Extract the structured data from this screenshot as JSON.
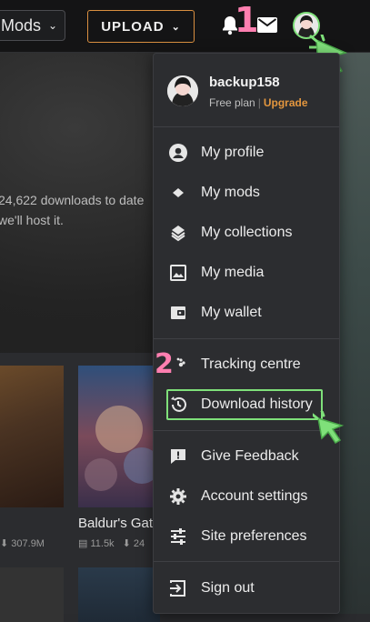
{
  "topbar": {
    "mods_label": "Mods",
    "upload_label": "UPLOAD"
  },
  "hero": {
    "line1": "24,622 downloads to date",
    "line2": "we'll host it."
  },
  "cards": {
    "card2_title": "Baldur's Gate",
    "stats": [
      "307.9M",
      "11.5k",
      "24"
    ]
  },
  "menu": {
    "username": "backup158",
    "plan": "Free plan",
    "upgrade": "Upgrade",
    "items": [
      {
        "label": "My profile",
        "icon": "person-circle-icon"
      },
      {
        "label": "My mods",
        "icon": "diamond-icon"
      },
      {
        "label": "My collections",
        "icon": "layers-icon"
      },
      {
        "label": "My media",
        "icon": "image-icon"
      },
      {
        "label": "My wallet",
        "icon": "wallet-icon"
      },
      {
        "label": "Tracking centre",
        "icon": "paw-icon"
      },
      {
        "label": "Download history",
        "icon": "history-icon"
      },
      {
        "label": "Give Feedback",
        "icon": "feedback-icon"
      },
      {
        "label": "Account settings",
        "icon": "gear-icon"
      },
      {
        "label": "Site preferences",
        "icon": "sliders-icon"
      },
      {
        "label": "Sign out",
        "icon": "sign-out-icon"
      }
    ]
  },
  "annotations": {
    "step1": "1",
    "step2": "2",
    "highlight_color": "#7fe07a",
    "number_color": "#ff7fb0"
  }
}
